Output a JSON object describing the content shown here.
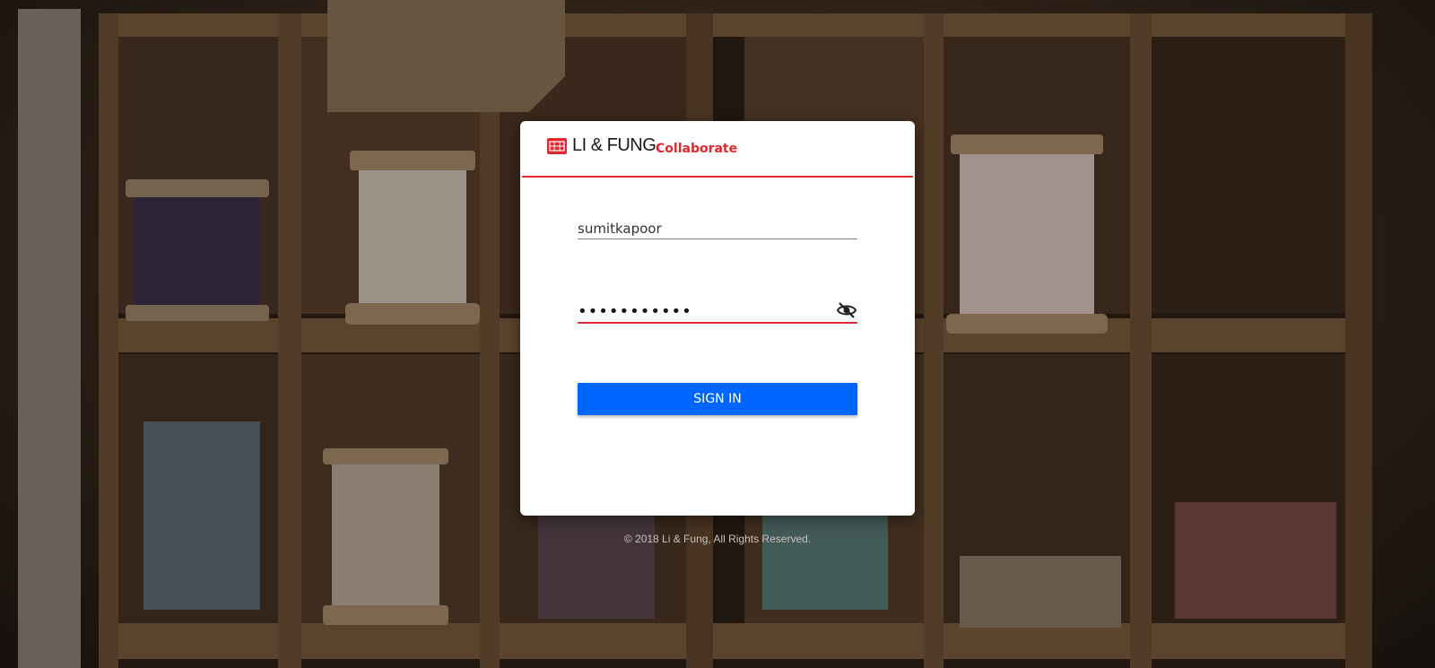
{
  "brand": {
    "name": "LI & FUNG",
    "product": "Collaborate",
    "accent_color": "#e3262d",
    "primary_color": "#0066ff"
  },
  "login": {
    "username_value": "sumitkapoor",
    "password_value": "•••••••••••",
    "toggle_icon": "eye-off-icon",
    "signin_label": "SIGN IN"
  },
  "footer": {
    "copyright": "© 2018 Li & Fung, All Rights Reserved."
  }
}
